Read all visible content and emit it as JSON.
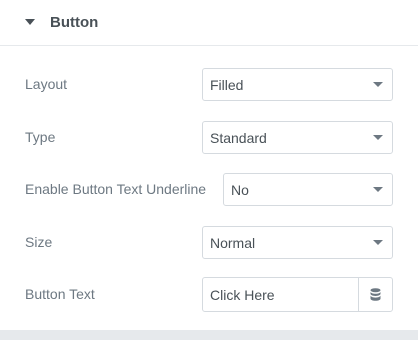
{
  "section": {
    "title": "Button",
    "toggle_icon": "caret-down-icon"
  },
  "controls": {
    "layout": {
      "label": "Layout",
      "value": "Filled"
    },
    "type": {
      "label": "Type",
      "value": "Standard"
    },
    "underline": {
      "label": "Enable Button Text Underline",
      "value": "No"
    },
    "size": {
      "label": "Size",
      "value": "Normal"
    },
    "button_text": {
      "label": "Button Text",
      "value": "Click Here",
      "dynamic_icon": "database-icon"
    }
  }
}
